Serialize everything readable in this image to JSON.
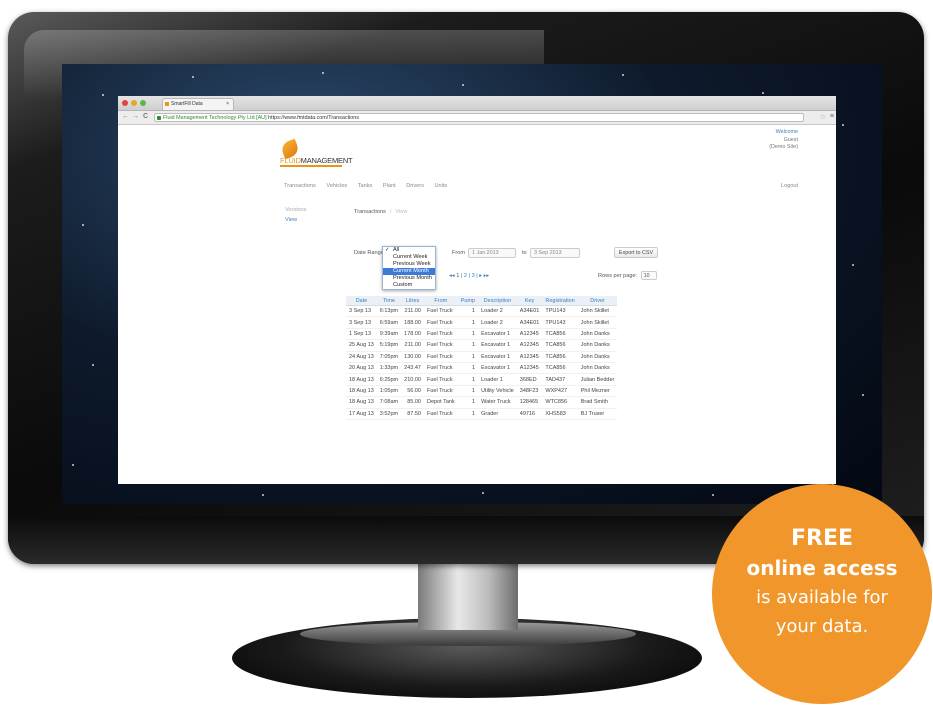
{
  "browser": {
    "tab_title": "SmartFill Data",
    "tab_close": "×",
    "nav_back": "←",
    "nav_forward": "→",
    "nav_reload": "C",
    "address_secure": "Fluid Management Technology Pty Ltd [AU]",
    "address_url": "https://www.fmtdata.com/Transactions",
    "bookmark_star": "☆",
    "menu": "≡"
  },
  "site": {
    "logo_prefix": "FLUID",
    "logo_suffix": "MANAGEMENT",
    "welcome": "Welcome",
    "user": "Guest",
    "site_name": "(Demo Site)",
    "nav": [
      "Transactions",
      "Vehicles",
      "Tanks",
      "Plant",
      "Drivers",
      "Units"
    ],
    "logout": "Logout"
  },
  "sidebar": {
    "header": "Versions",
    "item": "View"
  },
  "breadcrumb": {
    "section": "Transactions",
    "separator": "/",
    "current": "View"
  },
  "filters": {
    "date_range_label": "Date Range:",
    "from_label": "From",
    "from_value": "1 Jan 2013",
    "to_label": "to",
    "to_value": "3 Sep 2013",
    "export_label": "Export to CSV",
    "dropdown_check": "✓",
    "options": [
      "All",
      "Current Week",
      "Previous Week",
      "Current Month",
      "Previous Month",
      "Custom"
    ],
    "selected_option": "Current Month"
  },
  "pagination": {
    "prev": "◂◂",
    "pages": [
      "1",
      "2",
      "3"
    ],
    "next": "▸ ▸▸",
    "rows_per_page_label": "Rows per page:",
    "rows_per_page_value": "10"
  },
  "table": {
    "headers": [
      "Date",
      "Time",
      "Litres",
      "From",
      "Pump",
      "Description",
      "Key",
      "Registration",
      "Driver"
    ],
    "rows": [
      [
        "3 Sep 13",
        "6:13pm",
        "211.00",
        "Fuel Truck",
        "1",
        "Loader 2",
        "A34E01",
        "TPU143",
        "John Skillet"
      ],
      [
        "3 Sep 13",
        "6:59am",
        "188.00",
        "Fuel Truck",
        "1",
        "Loader 2",
        "A34E01",
        "TPU143",
        "John Skillet"
      ],
      [
        "1 Sep 13",
        "9:39am",
        "178.00",
        "Fuel Truck",
        "1",
        "Excavator 1",
        "A12345",
        "TCA856",
        "John Danks"
      ],
      [
        "25 Aug 13",
        "5:19pm",
        "211.00",
        "Fuel Truck",
        "1",
        "Excavator 1",
        "A12345",
        "TCA856",
        "John Danks"
      ],
      [
        "24 Aug 13",
        "7:05pm",
        "130.00",
        "Fuel Truck",
        "1",
        "Excavator 1",
        "A12345",
        "TCA856",
        "John Danks"
      ],
      [
        "20 Aug 13",
        "1:33pm",
        "243.47",
        "Fuel Truck",
        "1",
        "Excavator 1",
        "A12345",
        "TCA856",
        "John Danks"
      ],
      [
        "18 Aug 13",
        "6:25pm",
        "210.00",
        "Fuel Truck",
        "1",
        "Loader 1",
        "368ED",
        "TAD437",
        "Julian Bedder"
      ],
      [
        "18 Aug 13",
        "1:05pm",
        "56.00",
        "Fuel Truck",
        "1",
        "Utility Vehicle",
        "348F23",
        "WXP427",
        "Phil Mezner"
      ],
      [
        "18 Aug 13",
        "7:08am",
        "85.00",
        "Depot Tank",
        "1",
        "Water Truck",
        "128465",
        "WTC856",
        "Brad Smith"
      ],
      [
        "17 Aug 13",
        "3:52pm",
        "87.50",
        "Fuel Truck",
        "1",
        "Grader",
        "49716",
        "XHS583",
        "BJ Truser"
      ]
    ]
  },
  "badge": {
    "line1": "FREE",
    "line2": "online access",
    "line3": "is available for",
    "line4": "your data."
  },
  "colors": {
    "badge": "#f0962a",
    "link": "#3a7fc0",
    "selected": "#3b7bd6",
    "brand": "#e8951e"
  }
}
